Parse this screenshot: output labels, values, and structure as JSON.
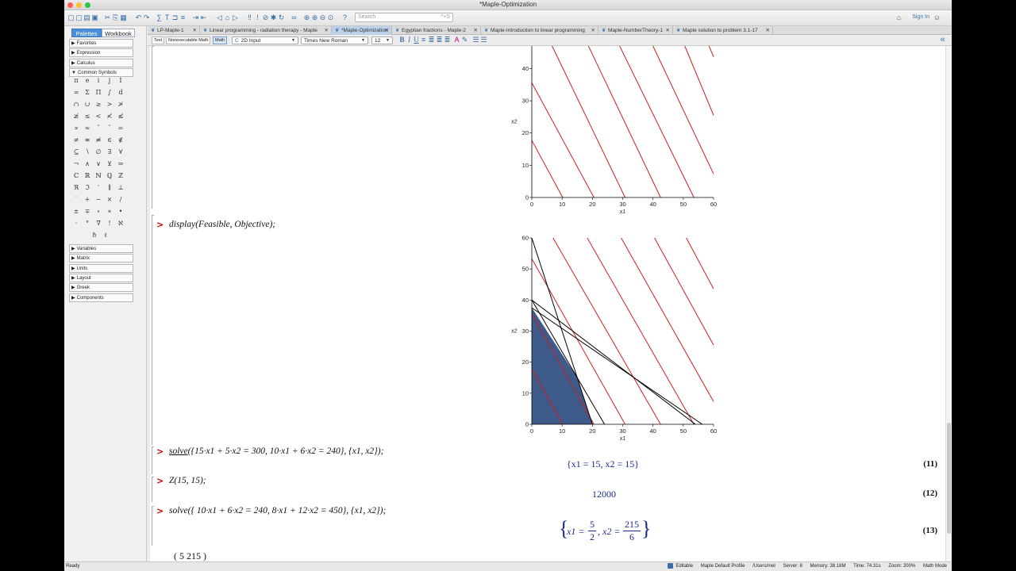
{
  "window": {
    "title": "*Maple-Optimization",
    "colors": {
      "close": "#ff5f57",
      "minimize": "#ffbd2e",
      "zoom": "#28c940"
    }
  },
  "toolbar": {
    "search_placeholder": "Search",
    "search_shortcut": "^+S",
    "signin_label": "Sign In"
  },
  "panel": {
    "tabs": [
      "Palettes",
      "Workbook"
    ],
    "palettes_top": [
      "Favorites",
      "Expression",
      "Calculus",
      "Common Symbols"
    ],
    "palettes_bottom": [
      "Variables",
      "Matrix",
      "Units",
      "Layout",
      "Greek",
      "Components"
    ],
    "symbols": [
      "π",
      "e",
      "i",
      "j",
      "I",
      "∞",
      "Σ",
      "Π",
      "∫",
      "d",
      "∩",
      "∪",
      "≥",
      ">",
      "≯",
      "≱",
      "≤",
      "<",
      "≮",
      "≰",
      "∝",
      "≈",
      "˜",
      "˜",
      "=",
      "≠",
      "≡",
      "≢",
      "∈",
      "∉",
      "⊆",
      "∖",
      "∅",
      "∃",
      "∀",
      "¬",
      "∧",
      "∨",
      "⊻",
      "⇒",
      "ℂ",
      "ℝ",
      "ℕ",
      "ℚ",
      "ℤ",
      "ℜ",
      "ℑ",
      "′",
      "∥",
      "⊥",
      "˙",
      "+",
      "−",
      "×",
      "/",
      "±",
      "∓",
      "∘",
      "∗",
      "•",
      "·",
      "°",
      "∇",
      "!",
      "ℵ",
      "ℏ",
      "ℓ"
    ]
  },
  "doc_tabs": [
    {
      "label": "LP-Maple-1",
      "active": false
    },
    {
      "label": "Linear programming - radiation therapy - Maple",
      "active": false
    },
    {
      "label": "*Maple-Optimization",
      "active": true
    },
    {
      "label": "Egyptian fractions - Maple-2",
      "active": false
    },
    {
      "label": "Maple-Introduction to linear programming",
      "active": false
    },
    {
      "label": "Maple-NumberTheory-1",
      "active": false
    },
    {
      "label": "Maple solution to problem 3.1-17",
      "active": false
    }
  ],
  "context_bar": {
    "text_btn": "Text",
    "nonexec_btn": "Nonexecutable Math",
    "math_btn": "Math",
    "mode_select": "2D Input",
    "font_select": "Times New Roman",
    "size_select": "12"
  },
  "document": {
    "prompt": ">",
    "cmd1": "display(Feasible, Objective);",
    "cmd2_solve": "solve",
    "cmd2_rest": "({15·x1 + 5·x2 = 300, 10·x1 + 6·x2 = 240}, {x1, x2});",
    "out2": "{x1 = 15, x2 = 15}",
    "num2": "(11)",
    "cmd3": "Z(15, 15);",
    "out3": "12000",
    "num3": "(12)",
    "cmd4": "solve({ 10·x1 + 6·x2 = 240, 8·x1 + 12·x2 = 450}, {x1, x2});",
    "out4_lhs1": "x1 =",
    "out4_n1": "5",
    "out4_d1": "2",
    "out4_lhs2": ", x2 =",
    "out4_n2": "215",
    "out4_d2": "6",
    "num4": "(13)",
    "partial": "(  5      215  )"
  },
  "chart_data": [
    {
      "type": "line",
      "title": "",
      "xlabel": "x1",
      "ylabel": "x2",
      "xlim": [
        0,
        60
      ],
      "ylim": [
        0,
        47
      ],
      "xticks": [
        0,
        10,
        20,
        30,
        40,
        50,
        60
      ],
      "yticks": [
        0,
        10,
        20,
        30,
        40
      ],
      "objective_color": "#cc2020",
      "series": [
        {
          "x": [
            0,
            10.2
          ],
          "y": [
            17.7,
            0
          ]
        },
        {
          "x": [
            0,
            20.5
          ],
          "y": [
            35.6,
            0
          ]
        },
        {
          "x": [
            6.7,
            30.8
          ],
          "y": [
            47,
            0
          ]
        },
        {
          "x": [
            18.7,
            42.5
          ],
          "y": [
            47,
            0
          ]
        },
        {
          "x": [
            29,
            53.5
          ],
          "y": [
            47,
            0
          ]
        },
        {
          "x": [
            40,
            60
          ],
          "y": [
            47,
            7.3
          ]
        },
        {
          "x": [
            50.5,
            60
          ],
          "y": [
            47,
            25.5
          ]
        },
        {
          "x": [
            58.5,
            60
          ],
          "y": [
            47,
            43.6
          ]
        }
      ]
    },
    {
      "type": "area",
      "title": "",
      "xlabel": "x1",
      "ylabel": "x2",
      "xlim": [
        0,
        60
      ],
      "ylim": [
        0,
        60
      ],
      "xticks": [
        0,
        10,
        20,
        30,
        40,
        50,
        60
      ],
      "yticks": [
        0,
        10,
        20,
        30,
        40,
        50,
        60
      ],
      "feasible_color": "#3d5a8a",
      "objective_color": "#cc2020",
      "constraint_color": "#000000",
      "feasible_region": {
        "x": [
          0,
          0,
          15,
          20
        ],
        "y": [
          0,
          37.5,
          15,
          0
        ]
      },
      "constraints": [
        {
          "x": [
            0,
            20
          ],
          "y": [
            60,
            0
          ]
        },
        {
          "x": [
            0,
            24
          ],
          "y": [
            40,
            0
          ]
        },
        {
          "x": [
            0,
            56.25
          ],
          "y": [
            37.5,
            0
          ]
        },
        {
          "x": [
            0,
            54
          ],
          "y": [
            40,
            0
          ]
        }
      ],
      "objective_lines": [
        {
          "x": [
            0,
            10.2
          ],
          "y": [
            17.7,
            0
          ]
        },
        {
          "x": [
            0,
            20.5
          ],
          "y": [
            35.6,
            0
          ]
        },
        {
          "x": [
            0,
            30.8
          ],
          "y": [
            53.3,
            0
          ]
        },
        {
          "x": [
            7,
            42.5
          ],
          "y": [
            60,
            0
          ]
        },
        {
          "x": [
            18.3,
            53.5
          ],
          "y": [
            60,
            0
          ]
        },
        {
          "x": [
            29.5,
            60
          ],
          "y": [
            60,
            7.3
          ]
        },
        {
          "x": [
            40.5,
            60
          ],
          "y": [
            60,
            25.5
          ]
        },
        {
          "x": [
            51,
            60
          ],
          "y": [
            60,
            43.6
          ]
        }
      ]
    }
  ]
}
